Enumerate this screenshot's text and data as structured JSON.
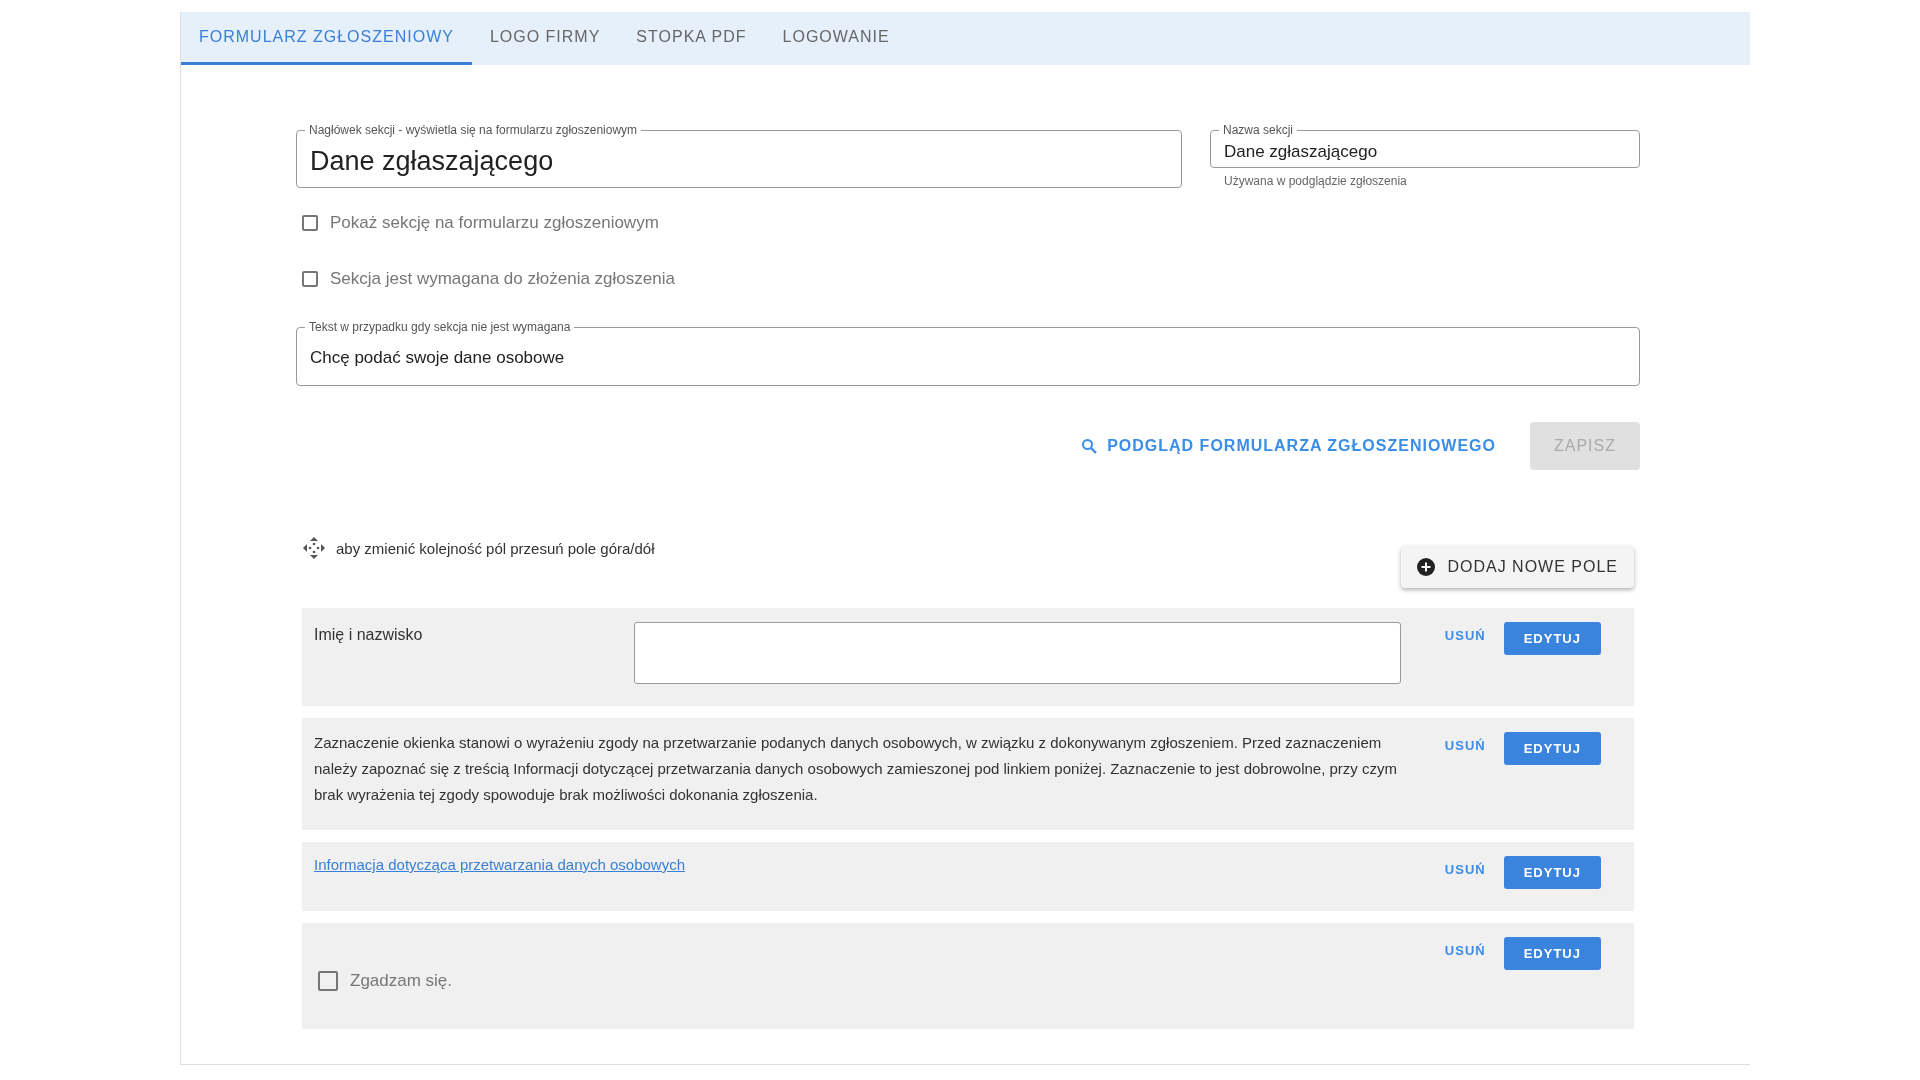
{
  "tabs": [
    {
      "label": "FORMULARZ ZGŁOSZENIOWY",
      "selected": true
    },
    {
      "label": "LOGO FIRMY",
      "selected": false
    },
    {
      "label": "STOPKA PDF",
      "selected": false
    },
    {
      "label": "LOGOWANIE",
      "selected": false
    }
  ],
  "section_header": {
    "label": "Nagłówek sekcji - wyświetla się na formularzu zgłoszeniowym",
    "value": "Dane zgłaszającego"
  },
  "section_name": {
    "label": "Nazwa sekcji",
    "value": "Dane zgłaszającego",
    "helper": "Używana w podglądzie zgłoszenia"
  },
  "options": [
    {
      "label": "Pokaż sekcję na formularzu zgłoszeniowym",
      "checked": false
    },
    {
      "label": "Sekcja jest wymagana do złożenia zgłoszenia",
      "checked": false
    }
  ],
  "optional_text": {
    "label": "Tekst w przypadku gdy sekcja nie jest wymagana",
    "value": "Chcę podać swoje dane osobowe"
  },
  "preview_button": "PODGLĄD FORMULARZA ZGŁOSZENIOWEGO",
  "save_button": {
    "label": "ZAPISZ",
    "disabled": true
  },
  "reorder_hint": "aby zmienić kolejność pól przesuń pole góra/dół",
  "add_field_button": "DODAJ NOWE POLE",
  "fields": [
    {
      "kind": "input",
      "label": "Imię i nazwisko",
      "delete": "USUŃ",
      "edit": "EDYTUJ"
    },
    {
      "kind": "text",
      "text": "Zaznaczenie okienka stanowi o wyrażeniu zgody na przetwarzanie podanych danych osobowych, w związku z dokonywanym zgłoszeniem. Przed zaznaczeniem należy zapoznać się z treścią Informacji dotyczącej przetwarzania danych osobowych zamieszonej pod linkiem poniżej. Zaznaczenie to jest dobrowolne, przy czym brak wyrażenia tej zgody spowoduje brak możliwości dokonania zgłoszenia.",
      "delete": "USUŃ",
      "edit": "EDYTUJ"
    },
    {
      "kind": "link",
      "text": " Informacja dotycząca przetwarzania danych osobowych",
      "delete": "USUŃ",
      "edit": "EDYTUJ"
    },
    {
      "kind": "checkbox",
      "label": "Zgadzam się.",
      "checked": false,
      "delete": "USUŃ",
      "edit": "EDYTUJ"
    }
  ]
}
